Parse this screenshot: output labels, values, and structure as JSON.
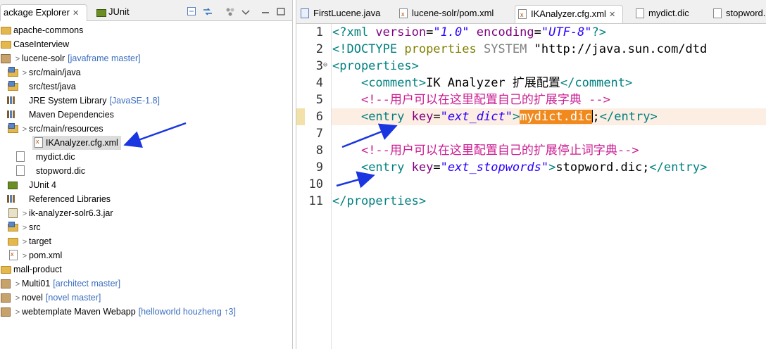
{
  "left_panel": {
    "tabs": [
      {
        "label": "ackage Explorer",
        "active": true
      },
      {
        "label": "JUnit",
        "active": false
      }
    ],
    "tree": [
      {
        "label": "apache-commons",
        "decoration": "",
        "icon": "folder-icon",
        "indent": 0,
        "arrow": ""
      },
      {
        "label": "CaseInterview",
        "decoration": "",
        "icon": "folder-icon",
        "indent": 0,
        "arrow": ""
      },
      {
        "label": "lucene-solr",
        "decoration": "[javaframe master]",
        "icon": "maven-project-icon",
        "indent": 0,
        "arrow": ">"
      },
      {
        "label": "src/main/java",
        "decoration": "",
        "icon": "source-folder-icon",
        "indent": 1,
        "arrow": ">"
      },
      {
        "label": "src/test/java",
        "decoration": "",
        "icon": "source-folder-icon",
        "indent": 1,
        "arrow": ""
      },
      {
        "label": "JRE System Library",
        "decoration": "[JavaSE-1.8]",
        "icon": "library-icon",
        "indent": 1,
        "arrow": ""
      },
      {
        "label": "Maven Dependencies",
        "decoration": "",
        "icon": "library-icon",
        "indent": 1,
        "arrow": ""
      },
      {
        "label": "src/main/resources",
        "decoration": "",
        "icon": "source-folder-icon",
        "indent": 1,
        "arrow": ">"
      },
      {
        "label": "IKAnalyzer.cfg.xml",
        "decoration": "",
        "icon": "xml-file-icon",
        "indent": 2,
        "arrow": "",
        "selected": true
      },
      {
        "label": "mydict.dic",
        "decoration": "",
        "icon": "file-icon",
        "indent": 2,
        "arrow": ""
      },
      {
        "label": "stopword.dic",
        "decoration": "",
        "icon": "file-icon",
        "indent": 2,
        "arrow": ""
      },
      {
        "label": "JUnit 4",
        "decoration": "",
        "icon": "junit-library-icon",
        "indent": 1,
        "arrow": ""
      },
      {
        "label": "Referenced Libraries",
        "decoration": "",
        "icon": "library-icon",
        "indent": 1,
        "arrow": ""
      },
      {
        "label": "ik-analyzer-solr6.3.jar",
        "decoration": "",
        "icon": "jar-icon",
        "indent": 1,
        "arrow": ">"
      },
      {
        "label": "src",
        "decoration": "",
        "icon": "source-folder-icon",
        "indent": 1,
        "arrow": ">"
      },
      {
        "label": "target",
        "decoration": "",
        "icon": "folder-icon",
        "indent": 1,
        "arrow": ">"
      },
      {
        "label": "pom.xml",
        "decoration": "",
        "icon": "xml-file-icon",
        "indent": 1,
        "arrow": ">"
      },
      {
        "label": "mall-product",
        "decoration": "",
        "icon": "folder-icon",
        "indent": 0,
        "arrow": ""
      },
      {
        "label": "Multi01",
        "decoration": "[architect master]",
        "icon": "maven-project-icon",
        "indent": 0,
        "arrow": ">"
      },
      {
        "label": "novel",
        "decoration": "[novel master]",
        "icon": "maven-project-icon",
        "indent": 0,
        "arrow": ">"
      },
      {
        "label": "webtemplate Maven Webapp",
        "decoration": "[helloworld houzheng ↑3]",
        "icon": "maven-project-icon",
        "indent": 0,
        "arrow": ">"
      }
    ]
  },
  "editor": {
    "tabs": [
      {
        "label": "FirstLucene.java",
        "icon": "java-file-icon",
        "active": false
      },
      {
        "label": "lucene-solr/pom.xml",
        "icon": "maven-pom-icon",
        "active": false
      },
      {
        "label": "IKAnalyzer.cfg.xml",
        "icon": "xml-file-icon",
        "active": true
      },
      {
        "label": "mydict.dic",
        "icon": "file-icon",
        "active": false
      },
      {
        "label": "stopword.",
        "icon": "file-icon",
        "active": false
      }
    ],
    "line_numbers": [
      "1",
      "2",
      "3",
      "4",
      "5",
      "6",
      "7",
      "8",
      "9",
      "10",
      "11"
    ],
    "code": {
      "l1_a": "<?xml ",
      "l1_b": "version",
      "l1_c": "=",
      "l1_d": "\"1.0\"",
      "l1_e": " encoding",
      "l1_f": "=",
      "l1_g": "\"UTF-8\"",
      "l1_h": "?>",
      "l2_a": "<!DOCTYPE ",
      "l2_b": "properties",
      "l2_c": " SYSTEM ",
      "l2_d": "\"http://java.sun.com/dtd",
      "l3_a": "<properties>",
      "l4_a": "<comment>",
      "l4_b": "IK Analyzer 扩展配置",
      "l4_c": "</comment>",
      "l5_a": "<!--用户可以在这里配置自己的扩展字典 -->",
      "l6_a": "<entry ",
      "l6_b": "key",
      "l6_c": "=",
      "l6_d": "\"ext_dict\"",
      "l6_e": ">",
      "l6_f": "mydict.dic",
      "l6_g": ";",
      "l6_h": "</entry>",
      "l8_a": "<!--用户可以在这里配置自己的扩展停止词字典-->",
      "l9_a": "<entry ",
      "l9_b": "key",
      "l9_c": "=",
      "l9_d": "\"ext_stopwords\"",
      "l9_e": ">",
      "l9_f": "stopword.dic;",
      "l9_g": "</entry>",
      "l11_a": "</properties>"
    }
  },
  "colors": {
    "selection_highlight": "#f08a1e",
    "current_line": "#fdeee3",
    "annotation_arrow": "#1a36e0"
  }
}
